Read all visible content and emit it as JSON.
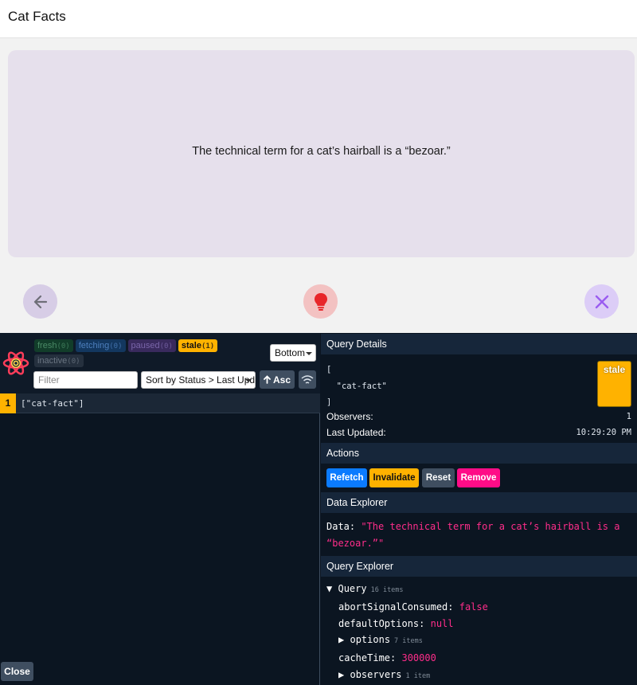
{
  "app": {
    "title": "Cat Facts",
    "fact": "The technical term for a cat’s hairball is a “bezoar.”"
  },
  "controls": {
    "back_icon": "arrow-left-icon",
    "hint_icon": "lightbulb-icon",
    "close_icon": "close-icon"
  },
  "devtools": {
    "badges": {
      "fresh": {
        "label": "fresh",
        "count": "(0)"
      },
      "fetching": {
        "label": "fetching",
        "count": "(0)"
      },
      "paused": {
        "label": "paused",
        "count": "(0)"
      },
      "stale": {
        "label": "stale",
        "count": "(1)"
      },
      "inactive": {
        "label": "inactive",
        "count": "(0)"
      }
    },
    "position_select": "Bottom",
    "filter_placeholder": "Filter",
    "sort_select": "Sort by Status > Last Upd",
    "sort_dir": "Asc",
    "query_row": {
      "count": "1",
      "key": "[\"cat-fact\"]"
    },
    "close_label": "Close",
    "details": {
      "heading": "Query Details",
      "key_lines": "[\n  \"cat-fact\"\n]",
      "status_badge": "stale",
      "observers_label": "Observers:",
      "observers_value": "1",
      "last_updated_label": "Last Updated:",
      "last_updated_value": "10:29:20 PM"
    },
    "actions": {
      "heading": "Actions",
      "refetch": "Refetch",
      "invalidate": "Invalidate",
      "reset": "Reset",
      "remove": "Remove"
    },
    "data_explorer": {
      "heading": "Data Explorer",
      "label": "Data:",
      "value": "\"The technical term for a cat’s hairball is a “bezoar.”\""
    },
    "query_explorer": {
      "heading": "Query Explorer",
      "root_label": "Query",
      "root_count": "16 items",
      "abort_label": "abortSignalConsumed:",
      "abort_value": "false",
      "default_label": "defaultOptions:",
      "default_value": "null",
      "options_label": "options",
      "options_count": "7 items",
      "cache_label": "cacheTime:",
      "cache_value": "300000",
      "observers_label": "observers",
      "observers_count": "1 item"
    },
    "colors": {
      "stale": "#ffb200",
      "refetch": "#0b7bff",
      "remove": "#ff0c87",
      "value_pink": "#ff2d8a"
    }
  }
}
